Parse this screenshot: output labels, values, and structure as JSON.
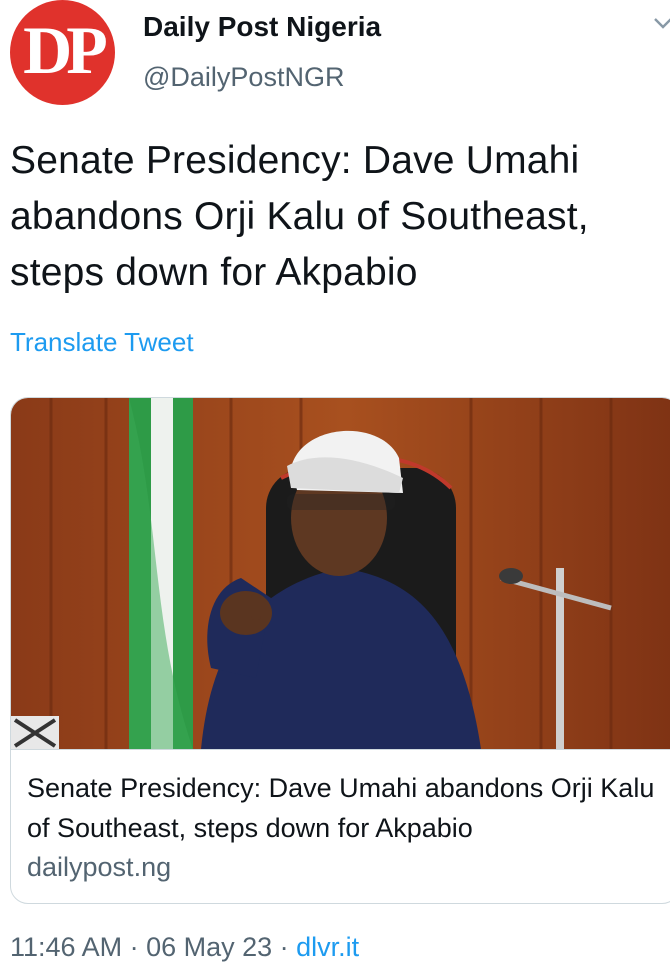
{
  "header": {
    "avatar_text": "DP",
    "display_name": "Daily Post Nigeria",
    "handle": "@DailyPostNGR",
    "more_icon": "chevron-down-icon"
  },
  "tweet": {
    "text": "Senate Presidency: Dave Umahi abandons Orji Kalu of Southeast, steps down for Akpabio",
    "translate_label": "Translate Tweet"
  },
  "card": {
    "image_alt": "Man in a white cap and navy shirt gesturing while seated in an office with a green-white-green flag",
    "title": "Senate Presidency: Dave Umahi abandons Orji Kalu of Southeast, steps down for Akpabio",
    "domain": "dailypost.ng"
  },
  "meta": {
    "time": "11:46 AM",
    "separator": " · ",
    "date": "06 May 23",
    "separator2": " · ",
    "source": "dlvr.it"
  },
  "colors": {
    "accent": "#1d9bf0",
    "avatar_bg": "#e0322c",
    "secondary_text": "#536471",
    "border": "#cfd9de"
  }
}
